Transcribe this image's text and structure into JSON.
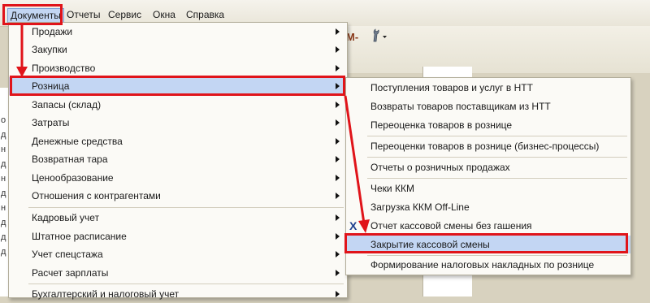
{
  "menubar": {
    "items": [
      "Документы",
      "Отчеты",
      "Сервис",
      "Окна",
      "Справка"
    ],
    "active_index": 0
  },
  "documents_menu": {
    "items": [
      {
        "label": "Продажи",
        "submenu": true
      },
      {
        "label": "Закупки",
        "submenu": true
      },
      {
        "label": "Производство",
        "submenu": true
      },
      {
        "label": "Розница",
        "submenu": true,
        "highlighted": true
      },
      {
        "label": "Запасы (склад)",
        "submenu": true
      },
      {
        "label": "Затраты",
        "submenu": true
      },
      {
        "label": "Денежные средства",
        "submenu": true
      },
      {
        "label": "Возвратная тара",
        "submenu": true
      },
      {
        "label": "Ценообразование",
        "submenu": true
      },
      {
        "label": "Отношения с контрагентами",
        "submenu": true
      },
      {
        "label": "Кадровый учет",
        "submenu": true
      },
      {
        "label": "Штатное расписание",
        "submenu": true
      },
      {
        "label": "Учет спецстажа",
        "submenu": true
      },
      {
        "label": "Расчет зарплаты",
        "submenu": true
      },
      {
        "label": "Бухгалтерский и налоговый учет",
        "submenu": true
      }
    ]
  },
  "retail_submenu": {
    "items": [
      {
        "label": "Поступления товаров и услуг в НТТ"
      },
      {
        "label": "Возвраты товаров поставщикам из НТТ"
      },
      {
        "label": "Переоценка товаров в рознице"
      },
      {
        "label": "Переоценки товаров в рознице (бизнес-процессы)"
      },
      {
        "label": "Отчеты о розничных продажах"
      },
      {
        "label": "Чеки ККМ"
      },
      {
        "label": "Загрузка ККМ Off-Line"
      },
      {
        "label": "Отчет кассовой смены без гашения",
        "icon": "x-report-icon"
      },
      {
        "label": "Закрытие кассовой смены",
        "highlighted": true
      },
      {
        "label": "Формирование налоговых накладных по рознице"
      }
    ]
  },
  "background": {
    "toolbar_fragment": "M-",
    "panel_buttons": [
      "□",
      "✕"
    ],
    "left_strip_letters": [
      "о",
      "д",
      "н",
      "д",
      "н",
      "д",
      "н",
      "д",
      "д",
      "д"
    ]
  },
  "colors": {
    "highlight": "#c3d6f3",
    "annotation_red": "#e0141a",
    "menu_bg": "#fbfaf6"
  }
}
